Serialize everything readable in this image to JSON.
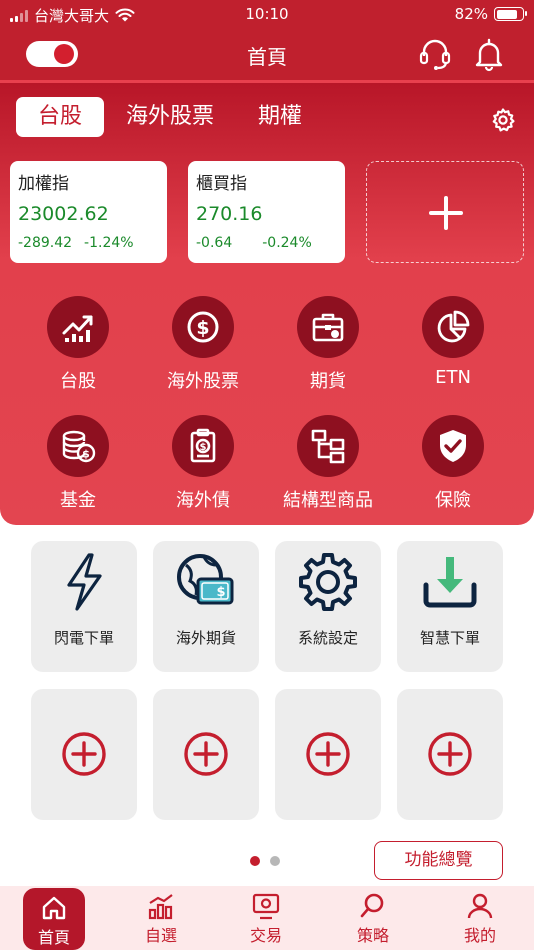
{
  "status_bar": {
    "carrier": "台灣大哥大",
    "time": "10:10",
    "battery": "82%",
    "battery_level": 0.82
  },
  "header": {
    "title": "首頁"
  },
  "tabs": [
    {
      "label": "台股"
    },
    {
      "label": "海外股票"
    },
    {
      "label": "期權"
    }
  ],
  "index_cards": [
    {
      "name": "加權指",
      "price": "23002.62",
      "change": "-289.42",
      "change_pct": "-1.24%"
    },
    {
      "name": "櫃買指",
      "price": "270.16",
      "change": "-0.64",
      "change_pct": "-0.24%"
    }
  ],
  "categories": [
    {
      "label": "台股",
      "icon": "trend-chart-icon"
    },
    {
      "label": "海外股票",
      "icon": "dollar-coin-icon"
    },
    {
      "label": "期貨",
      "icon": "briefcase-icon"
    },
    {
      "label": "ETN",
      "icon": "pie-chart-icon"
    },
    {
      "label": "基金",
      "icon": "coin-stack-icon"
    },
    {
      "label": "海外債",
      "icon": "bond-document-icon"
    },
    {
      "label": "結構型商品",
      "icon": "structure-icon"
    },
    {
      "label": "保險",
      "icon": "shield-check-icon"
    }
  ],
  "shortcuts": [
    {
      "label": "閃電下單",
      "icon": "lightning-icon"
    },
    {
      "label": "海外期貨",
      "icon": "globe-money-icon"
    },
    {
      "label": "系統設定",
      "icon": "settings-gear-icon"
    },
    {
      "label": "智慧下單",
      "icon": "download-tray-icon"
    }
  ],
  "overview_button": "功能總覽",
  "bottom_nav": [
    {
      "label": "首頁",
      "icon": "home-icon"
    },
    {
      "label": "自選",
      "icon": "bar-chart-icon"
    },
    {
      "label": "交易",
      "icon": "trade-icon"
    },
    {
      "label": "策略",
      "icon": "search-icon"
    },
    {
      "label": "我的",
      "icon": "user-icon"
    }
  ],
  "colors": {
    "brand_red": "#c0202e",
    "dark_red": "#8e1020",
    "price_green": "#1b8a2b",
    "tile_gray": "#ededed"
  }
}
